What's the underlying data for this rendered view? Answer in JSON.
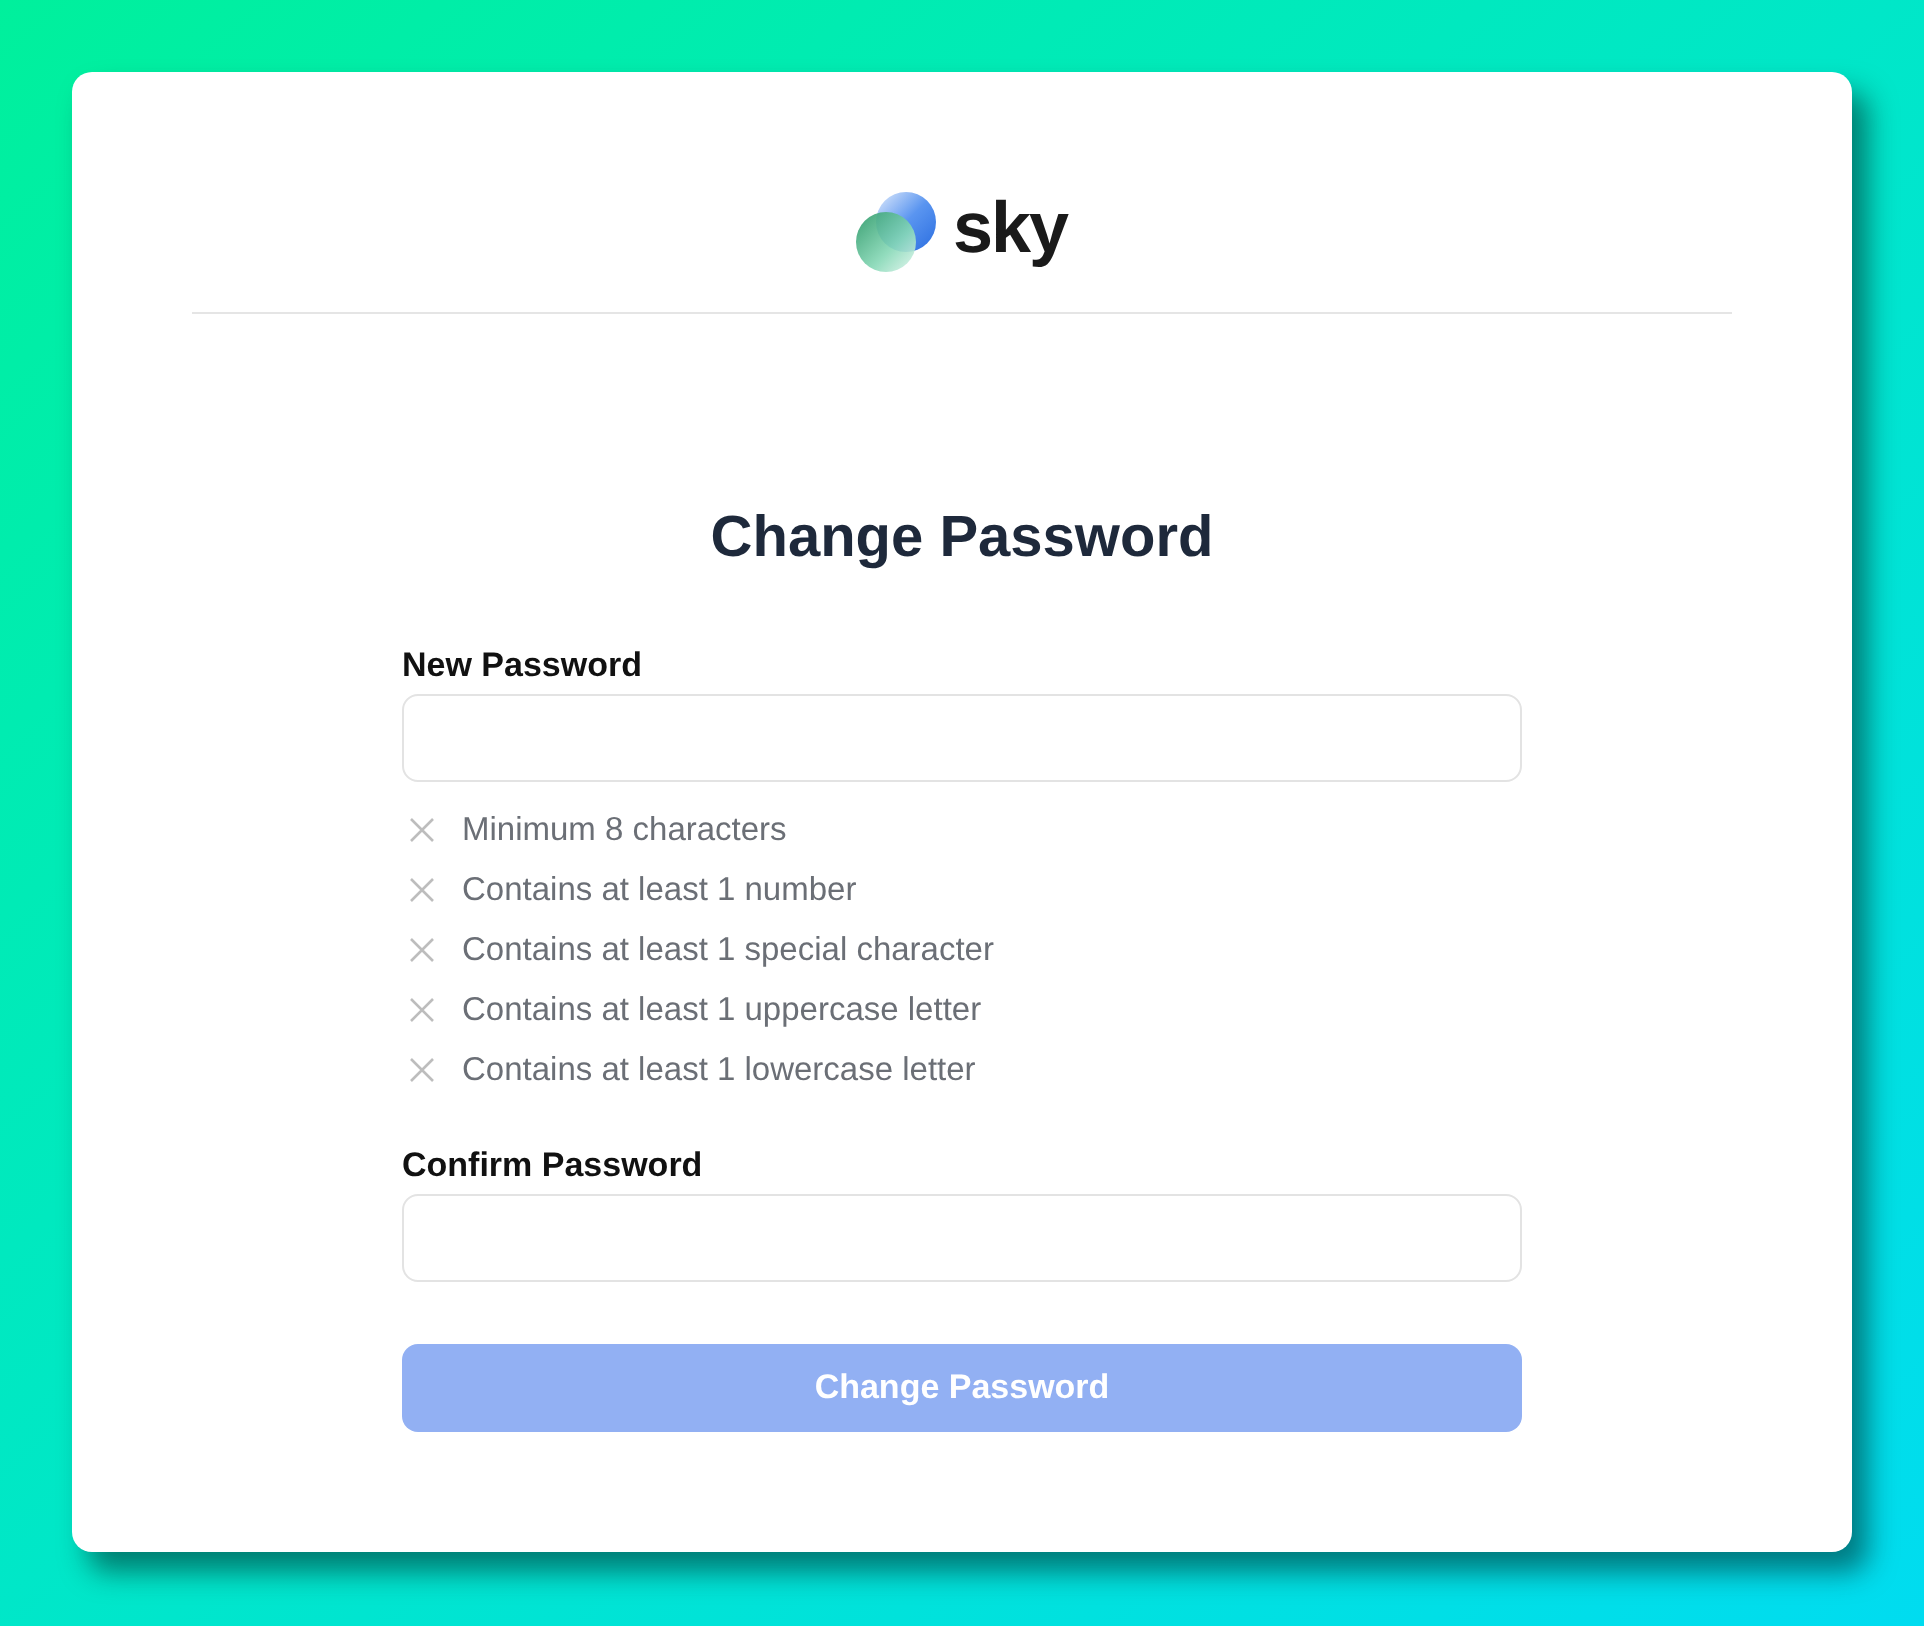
{
  "logo": {
    "text": "sky"
  },
  "title": "Change Password",
  "fields": [
    {
      "label": "New Password",
      "requirements": [
        {
          "text": "Minimum 8 characters",
          "met": false
        },
        {
          "text": "Contains at least 1 number",
          "met": false
        },
        {
          "text": "Contains at least 1 special character",
          "met": false
        },
        {
          "text": "Contains at least 1 uppercase letter",
          "met": false
        },
        {
          "text": "Contains at least 1 lowercase letter",
          "met": false
        }
      ]
    },
    {
      "label": "Confirm Password"
    }
  ],
  "submit": {
    "label": "Change Password",
    "disabled": true
  }
}
